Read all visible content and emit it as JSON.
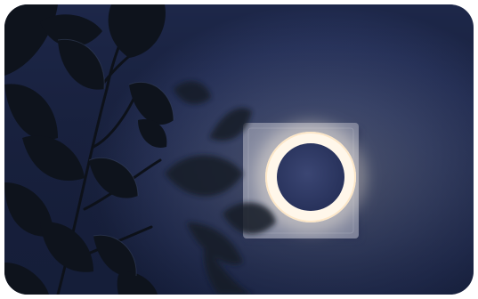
{
  "photo": {
    "subject": "night-light-on-wall-with-plant-silhouette",
    "colors": {
      "wall_center": "#5d6686",
      "wall_edge": "#1d2749",
      "plate": "#8e93a6",
      "ring_glow": "#fff6e8",
      "ring_inner": "#2f3a63",
      "leaf": "#0f141d"
    }
  }
}
